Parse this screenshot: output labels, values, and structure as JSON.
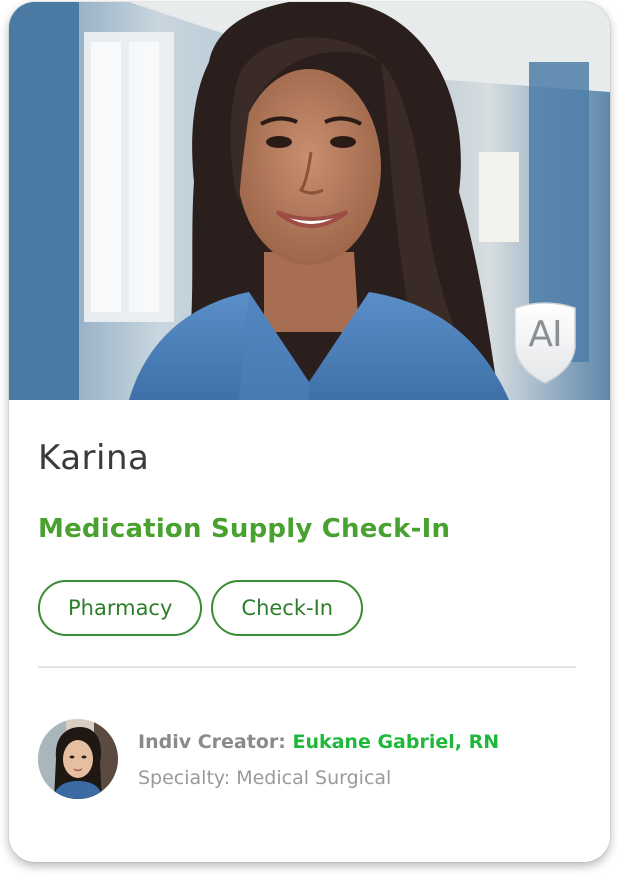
{
  "card": {
    "hero_image": "nurse-portrait-photo",
    "badge": {
      "label": "AI",
      "icon": "shield-icon"
    },
    "name": "Karina",
    "title": "Medication Supply Check-In",
    "tags": [
      "Pharmacy",
      "Check-In"
    ],
    "creator": {
      "label": "Indiv Creator:",
      "name": "Eukane Gabriel, RN",
      "specialty": "Specialty: Medical Surgical",
      "avatar": "creator-avatar-photo"
    }
  },
  "colors": {
    "accent_green": "#49a12f",
    "creator_green": "#1fb83a",
    "tag_border": "#3a8a33",
    "name_text": "#3b3b3b",
    "muted_text": "#8a8a8a"
  }
}
